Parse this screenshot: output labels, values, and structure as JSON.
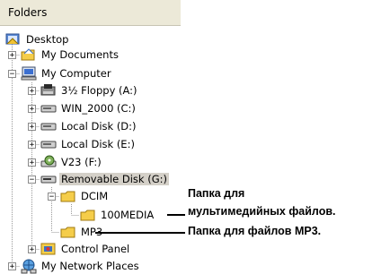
{
  "panel": {
    "title": "Folders"
  },
  "tree": {
    "desktop": "Desktop",
    "my_documents": "My Documents",
    "my_computer": "My Computer",
    "floppy": "3½ Floppy (A:)",
    "win2000": "WIN_2000 (C:)",
    "local_d": "Local Disk (D:)",
    "local_e": "Local Disk (E:)",
    "v23": "V23 (F:)",
    "removable": "Removable Disk (G:)",
    "dcim": "DCIM",
    "media100": "100MEDIA",
    "mp3": "MP3",
    "control_panel": "Control Panel",
    "network": "My Network Places"
  },
  "expanders": {
    "plus": "+",
    "minus": "−"
  },
  "annotations": {
    "multimedia_line1": "Папка для",
    "multimedia_line2": "мультимедийных файлов.",
    "mp3_note": "Папка для файлов MP3."
  },
  "colors": {
    "header_bg": "#ece9d8",
    "folder_yellow": "#f5cd4a",
    "selection": "#d4d0c8"
  },
  "icons": [
    "desktop-icon",
    "folder-icon",
    "computer-icon",
    "floppy-icon",
    "drive-icon",
    "cdrom-icon",
    "removable-drive-icon",
    "control-panel-icon",
    "network-icon"
  ]
}
